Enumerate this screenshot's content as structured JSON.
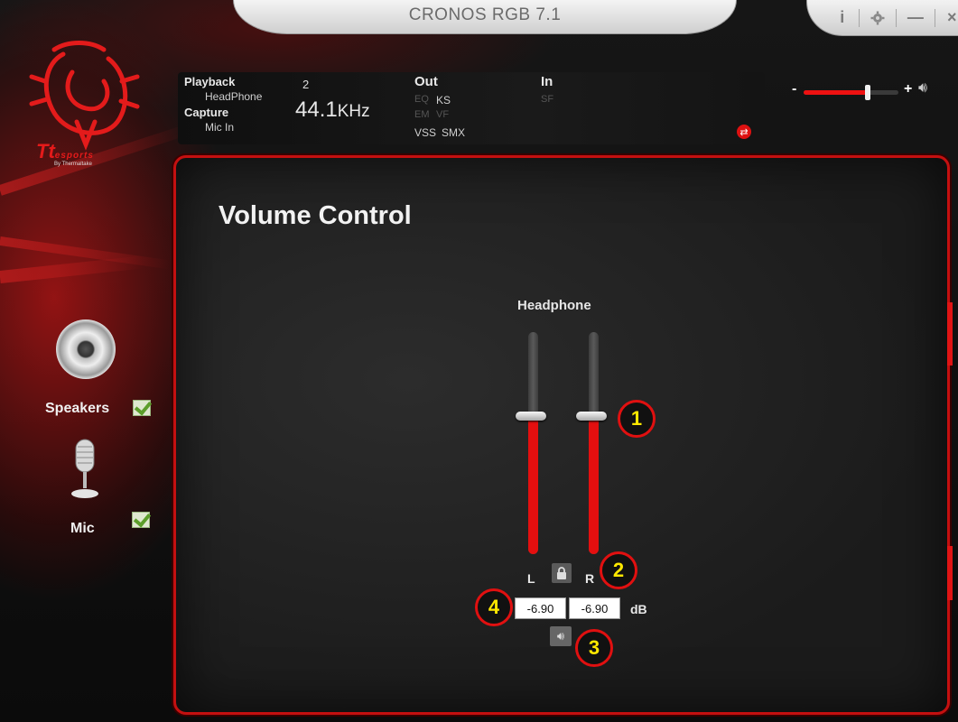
{
  "app": {
    "title": "CRONOS RGB 7.1"
  },
  "window_controls": {
    "info": "i",
    "settings_icon": "gear-icon",
    "minimize": "—",
    "close": "×"
  },
  "brand": {
    "logo": "Tt",
    "name": "esports",
    "sub": "By Thermaltake"
  },
  "info_panel": {
    "playback_label": "Playback",
    "playback_device": "HeadPhone",
    "channels": "2",
    "capture_label": "Capture",
    "capture_device": "Mic In",
    "sample_rate_value": "44.1",
    "sample_rate_unit": "KHz",
    "out_label": "Out",
    "out_eq": "EQ",
    "out_ks": "KS",
    "out_em": "EM",
    "out_vf": "VF",
    "out_vss": "VSS",
    "out_smx": "SMX",
    "in_label": "In",
    "in_sf": "SF"
  },
  "master_volume": {
    "minus": "-",
    "plus": "+",
    "level": 0.68
  },
  "sidebar": {
    "items": [
      {
        "label": "Speakers",
        "checked": true,
        "icon": "speaker-icon"
      },
      {
        "label": "Mic",
        "checked": true,
        "icon": "microphone-icon"
      }
    ]
  },
  "main": {
    "title": "Volume Control",
    "device_label": "Headphone",
    "left_channel": {
      "label": "L",
      "value": "-6.90",
      "level": 0.62
    },
    "right_channel": {
      "label": "R",
      "value": "-6.90",
      "level": 0.62
    },
    "unit": "dB"
  },
  "callouts": [
    "1",
    "2",
    "3",
    "4"
  ],
  "colors": {
    "accent": "#e40f0f",
    "callout_text": "#ffe800"
  }
}
